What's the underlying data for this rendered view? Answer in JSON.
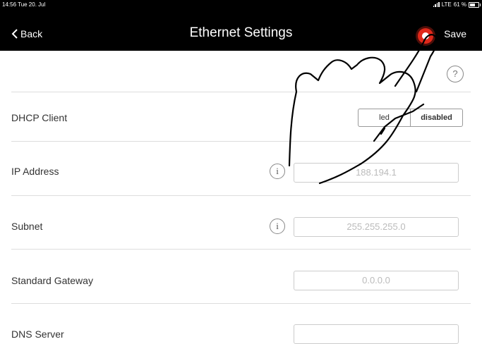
{
  "status_bar": {
    "time_date": "14:56  Tue 20. Jul",
    "network": "LTE",
    "battery": "61 %"
  },
  "nav": {
    "back_label": "Back",
    "title": "Ethernet Settings",
    "save_label": "Save"
  },
  "help_label": "?",
  "rows": {
    "dhcp": {
      "label": "DHCP Client",
      "options": [
        "enabled",
        "disabled"
      ],
      "visible_left": "led",
      "selected": "disabled"
    },
    "ip": {
      "label": "IP Address",
      "value": "188.194.1",
      "info": "i"
    },
    "subnet": {
      "label": "Subnet",
      "value": "255.255.255.0",
      "info": "i"
    },
    "gateway": {
      "label": "Standard Gateway",
      "value": "0.0.0.0"
    },
    "dns": {
      "label": "DNS Server",
      "value": ""
    }
  },
  "colors": {
    "nav_bg": "#000000",
    "record_indicator": "#e0281a",
    "field_text": "#bbbbbb"
  }
}
